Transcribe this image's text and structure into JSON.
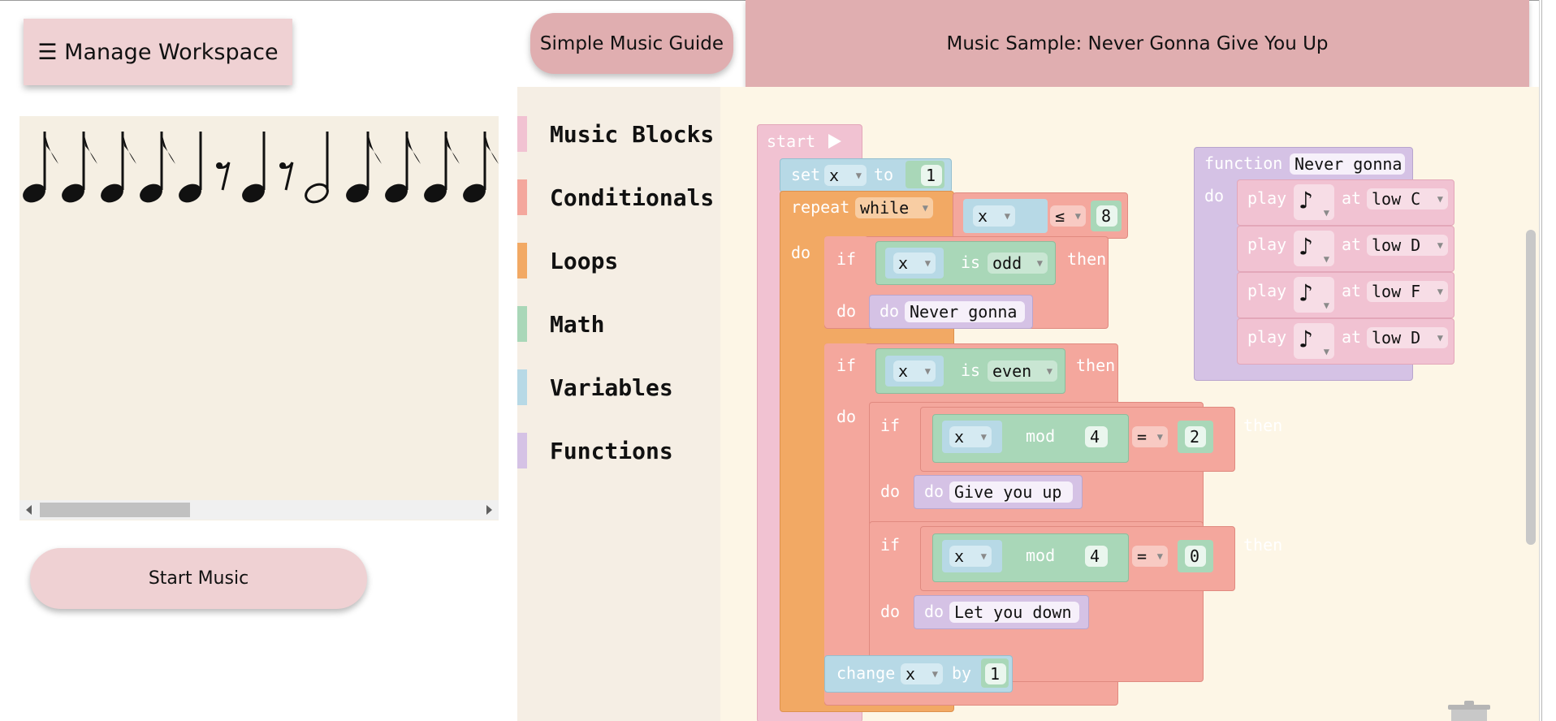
{
  "header": {
    "manage_label": "☰ Manage Workspace",
    "guide_label": "Simple Music Guide",
    "sample_label": "Music Sample: Never Gonna Give You Up"
  },
  "player": {
    "start_label": "Start Music"
  },
  "toolbox": {
    "categories": [
      {
        "label": "Music Blocks",
        "color": "#f1c2d2"
      },
      {
        "label": "Conditionals",
        "color": "#f4a79d"
      },
      {
        "label": "Loops",
        "color": "#f2a964"
      },
      {
        "label": "Math",
        "color": "#a9d7b8"
      },
      {
        "label": "Variables",
        "color": "#b7d9e6"
      },
      {
        "label": "Functions",
        "color": "#d5c2e5"
      }
    ]
  },
  "blocks": {
    "start": "start",
    "set": "set",
    "var_x": "x",
    "to": "to",
    "one": "1",
    "repeat": "repeat",
    "while": "while",
    "le": "≤",
    "eight": "8",
    "do": "do",
    "if": "if",
    "is": "is",
    "odd": "odd",
    "even": "even",
    "then": "then",
    "never_gonna": "Never gonna",
    "mod": "mod",
    "four": "4",
    "eq": "=",
    "two": "2",
    "zero": "0",
    "give_you_up": "Give you up",
    "let_you_down": "Let you down",
    "change": "change",
    "by": "by",
    "function": "function",
    "play": "play",
    "at": "at",
    "note_glyph": "♪",
    "notes": [
      "low C",
      "low D",
      "low F",
      "low D"
    ]
  },
  "colors": {
    "music": "#f1c2d2",
    "conditionals": "#f4a79d",
    "loops": "#f2a964",
    "math": "#a9d7b8",
    "variables": "#b7d9e6",
    "functions": "#d5c2e5",
    "button": "#efd1d3",
    "header": "#e0aeb0"
  },
  "score": {
    "notes": [
      "eighth",
      "eighth",
      "eighth",
      "eighth",
      "quarter",
      "eighth-rest",
      "quarter",
      "eighth-rest",
      "half",
      "eighth",
      "eighth",
      "eighth",
      "eighth"
    ]
  }
}
